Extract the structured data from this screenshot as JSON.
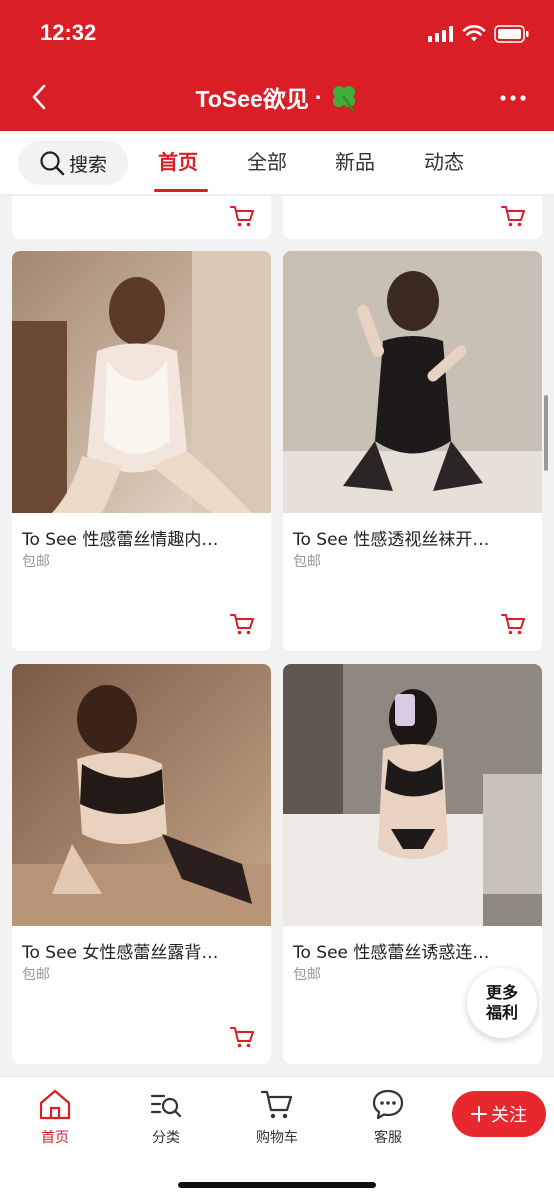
{
  "status_bar": {
    "time": "12:32"
  },
  "header": {
    "title": "ToSee欲见",
    "title_suffix": "·",
    "clover_icon": "four-leaf-clover-icon"
  },
  "tabs": {
    "search_label": "搜索",
    "items": [
      "首页",
      "全部",
      "新品",
      "动态"
    ],
    "active_index": 0
  },
  "products": [
    {
      "title": "To See 性感蕾丝情趣内…",
      "shipping": "包邮"
    },
    {
      "title": "To See 性感透视丝袜开…",
      "shipping": "包邮"
    },
    {
      "title": "To See 女性感蕾丝露背…",
      "shipping": "包邮"
    },
    {
      "title": "To See 性感蕾丝诱惑连…",
      "shipping": "包邮"
    }
  ],
  "floating": {
    "line1": "更多",
    "line2": "福利"
  },
  "bottom_nav": {
    "items": [
      {
        "label": "首页",
        "icon": "home-icon"
      },
      {
        "label": "分类",
        "icon": "category-search-icon"
      },
      {
        "label": "购物车",
        "icon": "cart-icon"
      },
      {
        "label": "客服",
        "icon": "chat-bubble-icon"
      }
    ],
    "follow_label": "关注"
  },
  "colors": {
    "brand_red": "#d91e26"
  }
}
